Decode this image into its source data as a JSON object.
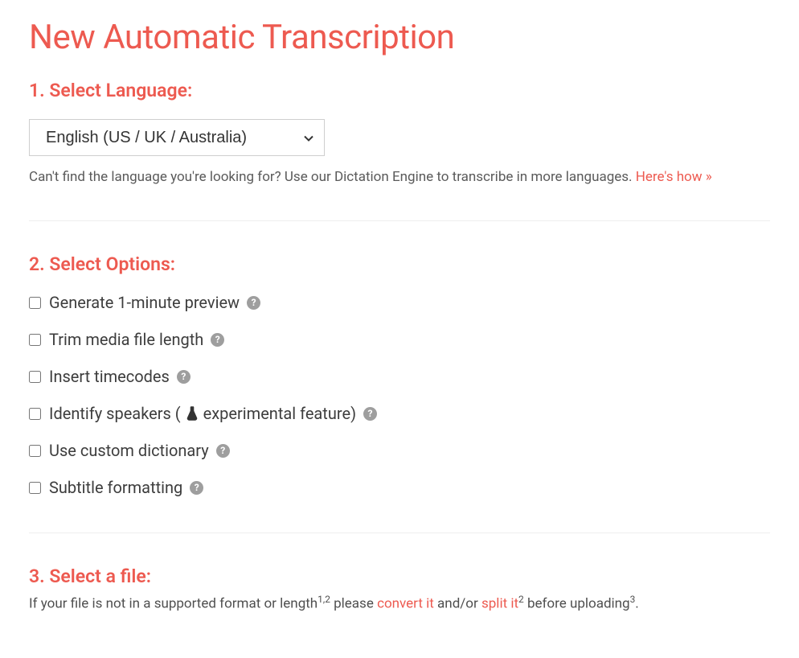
{
  "title": "New Automatic Transcription",
  "section1": {
    "heading": "1. Select Language:",
    "selected": "English (US / UK / Australia)",
    "hint": "Can't find the language you're looking for? Use our Dictation Engine to transcribe in more languages. ",
    "link": "Here's how »"
  },
  "section2": {
    "heading": "2. Select Options:",
    "options": [
      {
        "label": "Generate 1-minute preview"
      },
      {
        "label": "Trim media file length"
      },
      {
        "label": "Insert timecodes"
      },
      {
        "label_pre": "Identify speakers (",
        "label_post": " experimental feature)"
      },
      {
        "label": "Use custom dictionary"
      },
      {
        "label": "Subtitle formatting"
      }
    ]
  },
  "section3": {
    "heading": "3. Select a file:",
    "hint_part1": "If your file is not in a supported format or length",
    "hint_sup1": "1,2",
    "hint_part2": " please ",
    "hint_link1": "convert it",
    "hint_part3": " and/or ",
    "hint_link2": "split it",
    "hint_sup2": "2",
    "hint_part4": " before uploading",
    "hint_sup3": "3",
    "hint_part5": "."
  }
}
